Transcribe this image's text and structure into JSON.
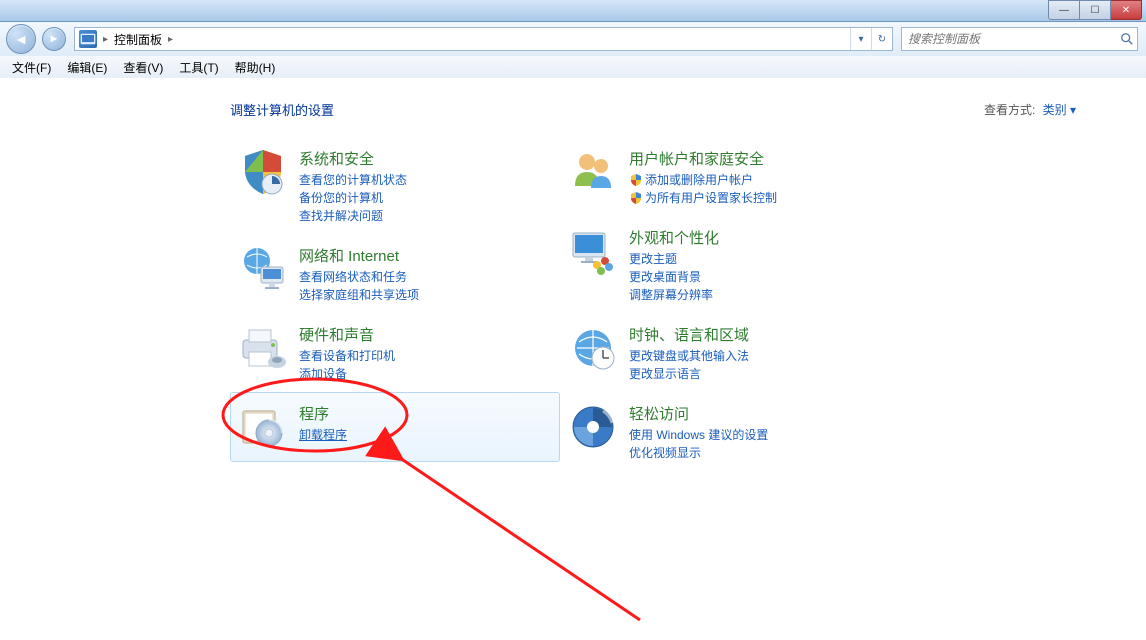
{
  "chrome": {
    "min_label": "—",
    "max_label": "☐",
    "close_label": "✕"
  },
  "address": {
    "crumb1": "控制面板",
    "refresh_label": "↻",
    "drop_label": "▾",
    "back_glyph": "◄",
    "fwd_glyph": "►",
    "sep_glyph": "▸"
  },
  "search": {
    "placeholder": "搜索控制面板",
    "magnifier": "🔍"
  },
  "menu": {
    "file": "文件(F)",
    "edit": "编辑(E)",
    "view": "查看(V)",
    "tools": "工具(T)",
    "help": "帮助(H)"
  },
  "header": {
    "title": "调整计算机的设置",
    "view_label": "查看方式:",
    "view_value": "类别 ▾"
  },
  "cats": {
    "system": {
      "title": "系统和安全",
      "links": [
        "查看您的计算机状态",
        "备份您的计算机",
        "查找并解决问题"
      ]
    },
    "network": {
      "title": "网络和 Internet",
      "links": [
        "查看网络状态和任务",
        "选择家庭组和共享选项"
      ]
    },
    "hardware": {
      "title": "硬件和声音",
      "links": [
        "查看设备和打印机",
        "添加设备"
      ]
    },
    "programs": {
      "title": "程序",
      "links": [
        "卸载程序"
      ]
    },
    "users": {
      "title": "用户帐户和家庭安全",
      "links": [
        "添加或删除用户帐户",
        "为所有用户设置家长控制"
      ]
    },
    "appearance": {
      "title": "外观和个性化",
      "links": [
        "更改主题",
        "更改桌面背景",
        "调整屏幕分辨率"
      ]
    },
    "clock": {
      "title": "时钟、语言和区域",
      "links": [
        "更改键盘或其他输入法",
        "更改显示语言"
      ]
    },
    "ease": {
      "title": "轻松访问",
      "links": [
        "使用 Windows 建议的设置",
        "优化视频显示"
      ]
    }
  }
}
